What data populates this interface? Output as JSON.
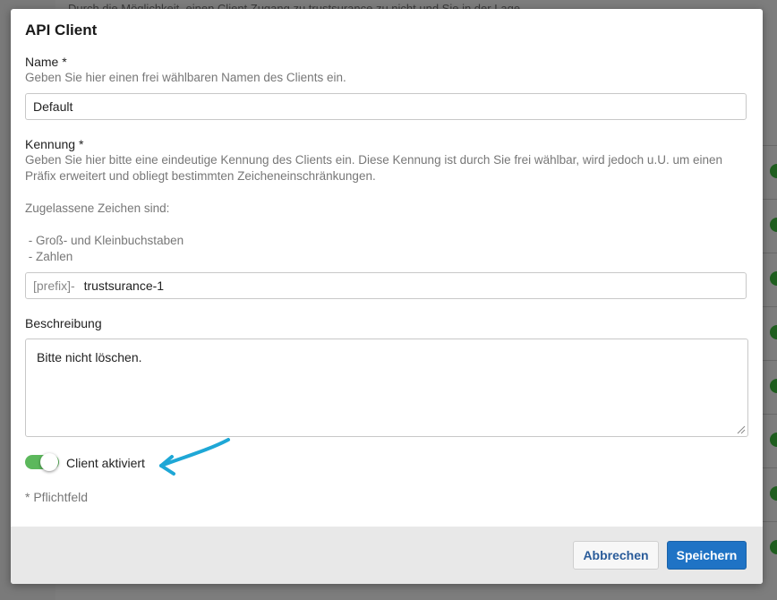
{
  "background": {
    "partial_text": "Durch die Möglichkeit, einen Client Zugang zu trustsurance zu nicht und Sie in der Lage..."
  },
  "modal": {
    "title": "API Client",
    "name": {
      "label": "Name *",
      "help": "Geben Sie hier einen frei wählbaren Namen des Clients ein.",
      "value": "Default"
    },
    "identifier": {
      "label": "Kennung *",
      "help_line1": "Geben Sie hier bitte eine eindeutige Kennung des Clients ein. Diese Kennung ist durch Sie frei wählbar, wird jedoch u.U. um einen",
      "help_line2": "Präfix erweitert und obliegt bestimmten Zeicheneinschränkungen.",
      "allowed_heading": "Zugelassene Zeichen sind:",
      "allowed_1": " - Groß- und Kleinbuchstaben",
      "allowed_2": " - Zahlen",
      "prefix": "[prefix]-",
      "value": "trustsurance-1"
    },
    "description": {
      "label": "Beschreibung",
      "value": "Bitte nicht löschen."
    },
    "active_toggle": {
      "label": "Client aktiviert",
      "on": true
    },
    "required_note": "* Pflichtfeld",
    "buttons": {
      "cancel": "Abbrechen",
      "save": "Speichern"
    }
  },
  "colors": {
    "toggle_on": "#5cb85c",
    "primary": "#1f73c5",
    "annotation_arrow": "#1ea7d6"
  }
}
